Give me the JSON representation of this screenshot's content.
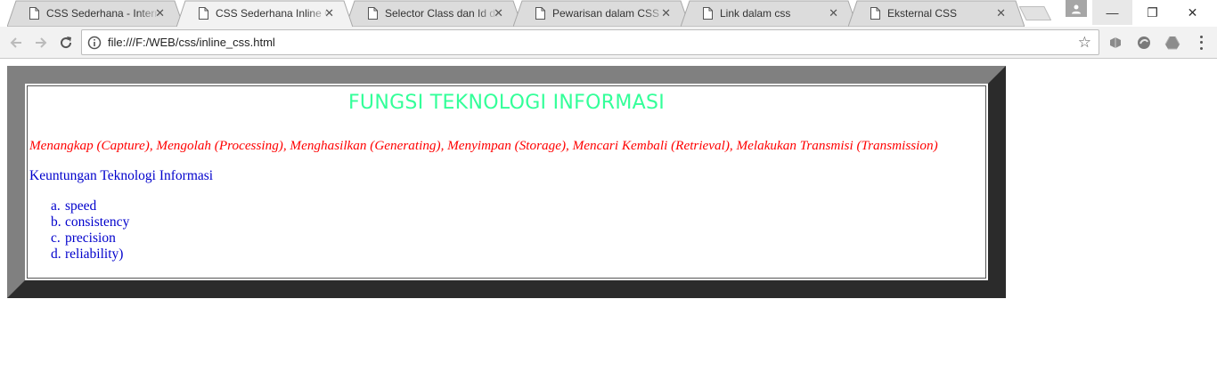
{
  "browser": {
    "tabs": [
      {
        "title": "CSS Sederhana - Internal",
        "active": false
      },
      {
        "title": "CSS Sederhana Inline CSS",
        "active": true
      },
      {
        "title": "Selector Class dan Id dalam",
        "active": false
      },
      {
        "title": "Pewarisan dalam CSS",
        "active": false
      },
      {
        "title": "Link dalam css",
        "active": false
      },
      {
        "title": "Eksternal CSS",
        "active": false
      }
    ],
    "close_glyph": "✕",
    "url": "file:///F:/WEB/css/inline_css.html",
    "window_controls": {
      "minimize": "—",
      "maximize": "❐",
      "close": "✕"
    },
    "star_glyph": "☆"
  },
  "page": {
    "heading": "FUNGSI TEKNOLOGI INFORMASI",
    "functions_text": "Menangkap (Capture), Mengolah (Processing), Menghasilkan (Generating), Menyimpan (Storage), Mencari Kembali (Retrieval), Melakukan Transmisi (Transmission)",
    "benefits_title": "Keuntungan Teknologi Informasi",
    "benefits": [
      {
        "marker": "a.",
        "text": "speed"
      },
      {
        "marker": "b.",
        "text": "consistency"
      },
      {
        "marker": "c.",
        "text": "precision"
      },
      {
        "marker": "d.",
        "text": "reliability)"
      }
    ]
  },
  "colors": {
    "heading": "#33ff99",
    "functions": "#ff0000",
    "benefits": "#0000cc",
    "border_light": "#808080",
    "border_dark": "#2b2b2b"
  }
}
